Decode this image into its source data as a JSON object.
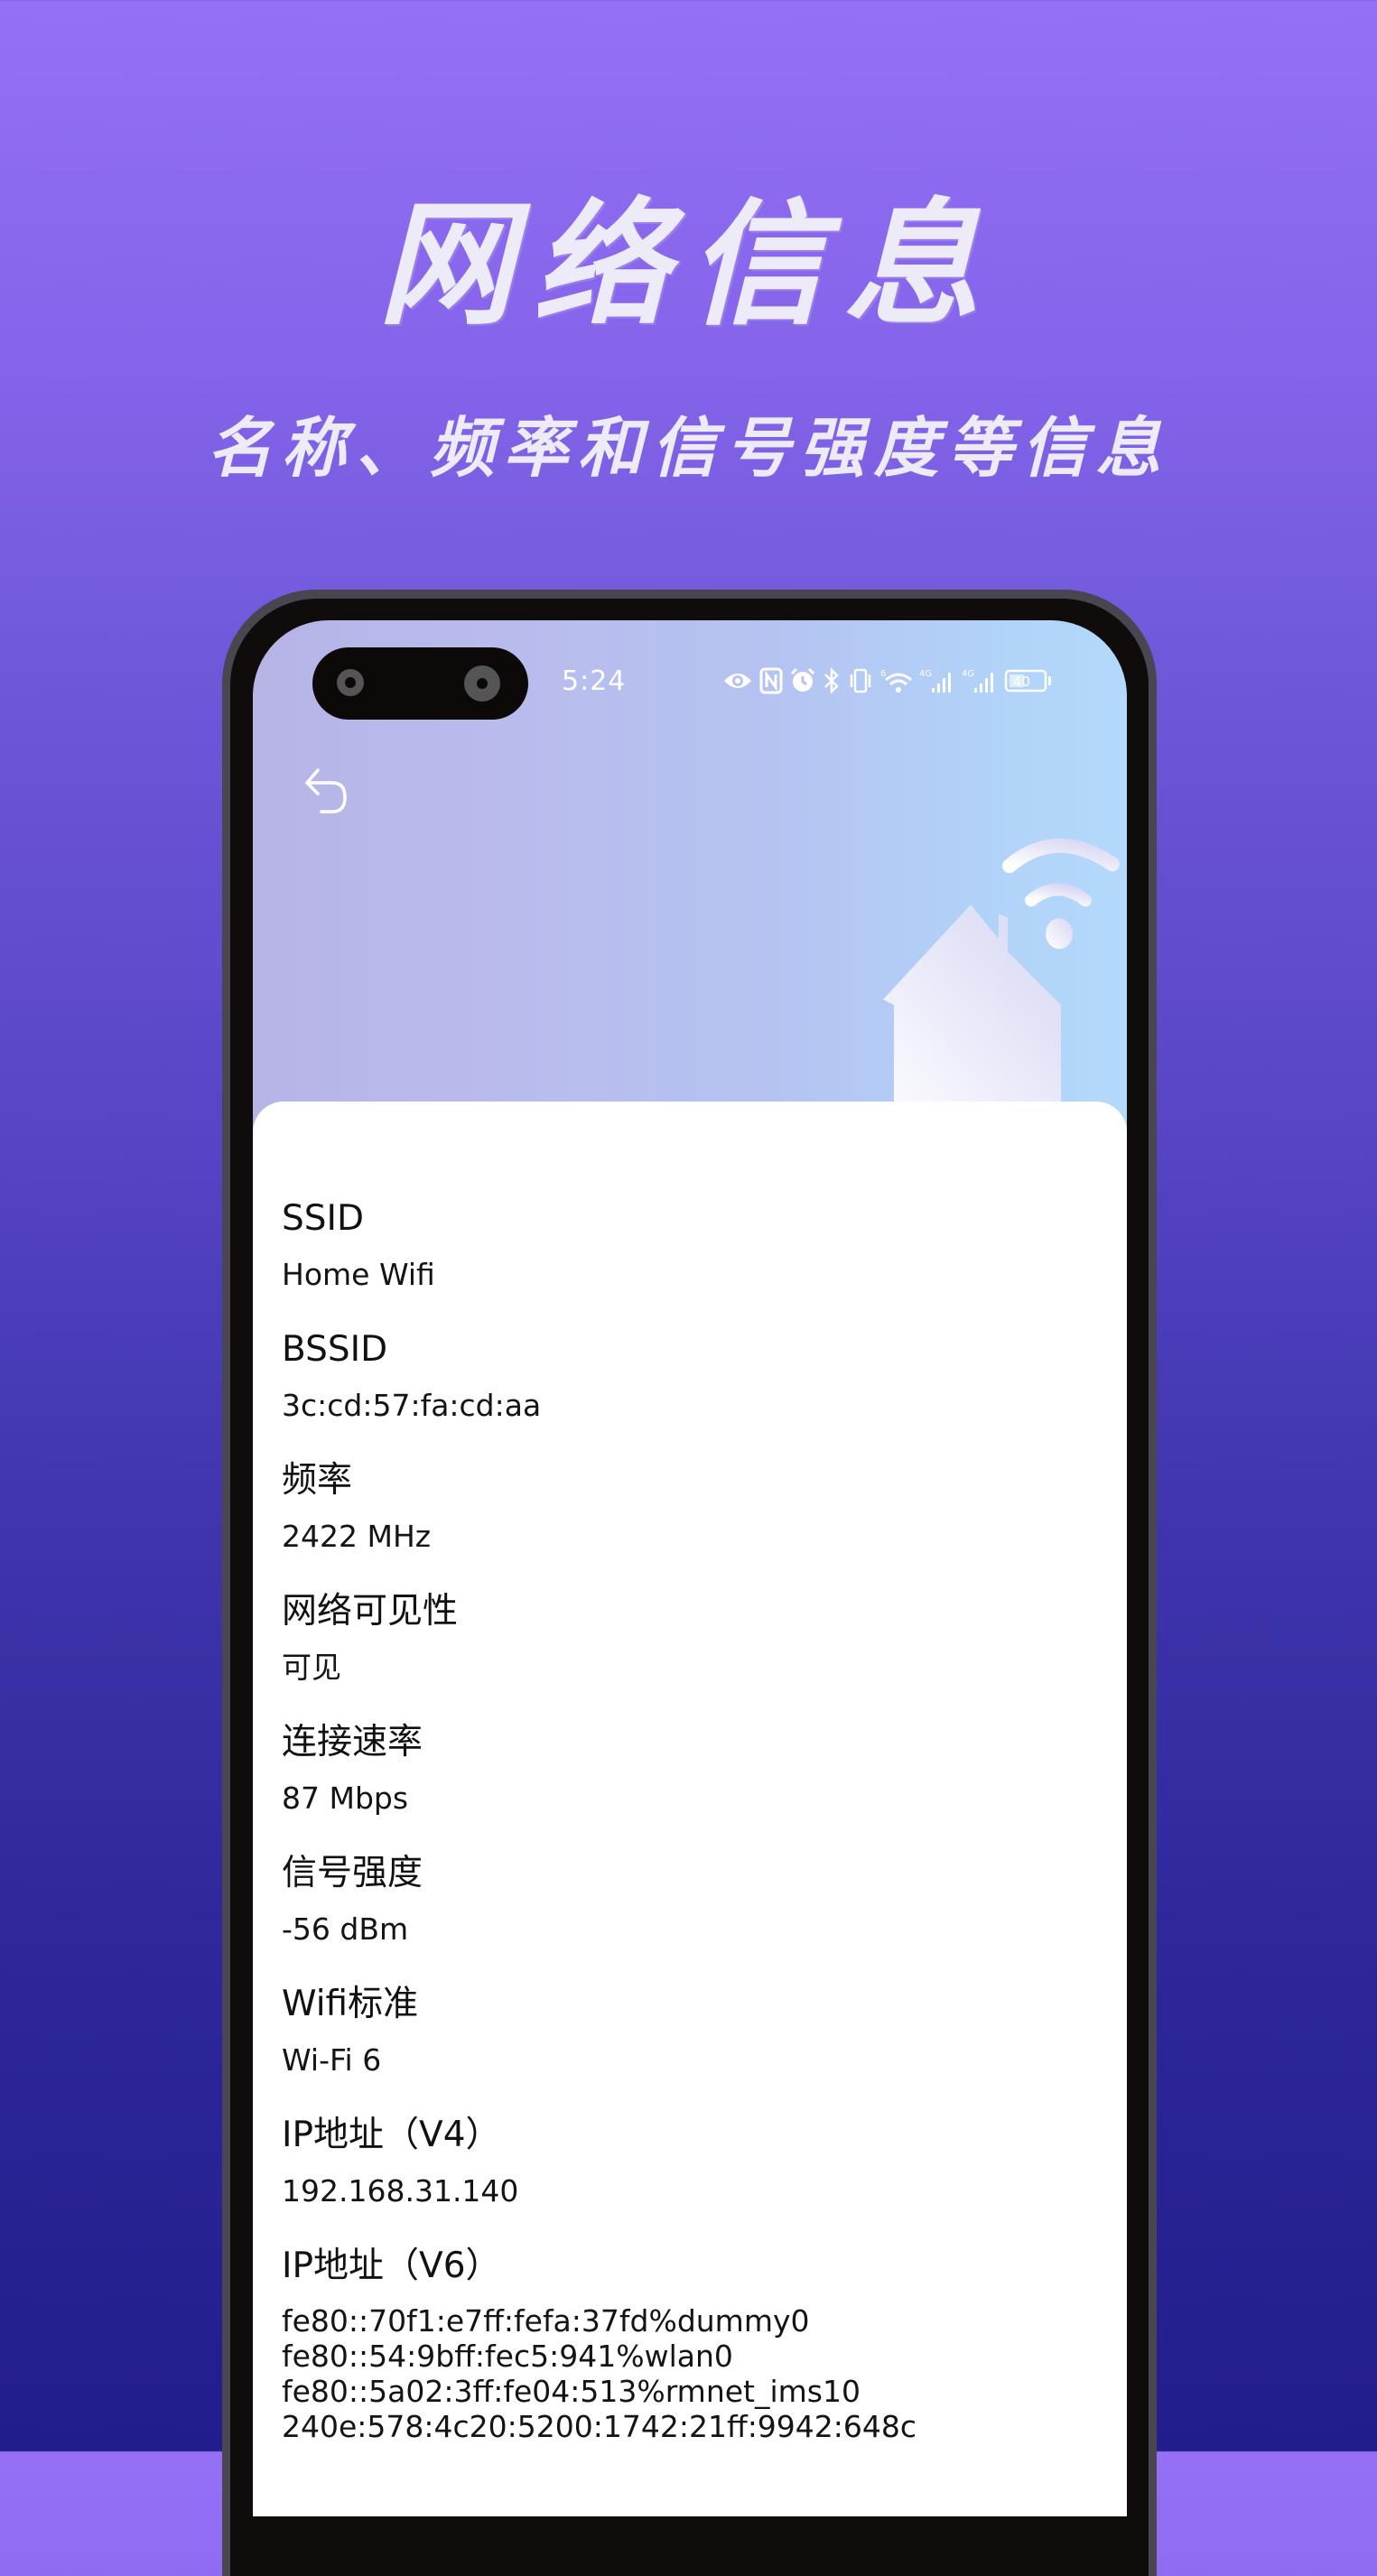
{
  "promo": {
    "headline": "网络信息",
    "subheadline": "名称、频率和信号强度等信息"
  },
  "status_bar": {
    "time": "5:24",
    "icons": [
      "eye-comfort-icon",
      "nfc-icon",
      "alarm-icon",
      "bluetooth-icon",
      "vibrate-icon",
      "wifi-6-icon",
      "signal-4g-1-icon",
      "signal-4g-2-icon",
      "battery-icon"
    ],
    "wifi_badge": "6",
    "network_badge_1": "4G",
    "network_badge_2": "4G",
    "battery_level": "40"
  },
  "header": {
    "back_icon": "back-arrow-icon",
    "illustration": "house-wifi-illustration"
  },
  "info": {
    "ssid": {
      "label": "SSID",
      "value": "Home Wifi"
    },
    "bssid": {
      "label": "BSSID",
      "value": "3c:cd:57:fa:cd:aa"
    },
    "frequency": {
      "label": "频率",
      "value": "2422 MHz"
    },
    "visibility": {
      "label": "网络可见性",
      "value": "可见"
    },
    "link_speed": {
      "label": "连接速率",
      "value": "87 Mbps"
    },
    "signal": {
      "label": "信号强度",
      "value": "-56 dBm"
    },
    "standard": {
      "label": "Wifi标准",
      "value": "Wi-Fi 6"
    },
    "ipv4": {
      "label": "IP地址（V4）",
      "value": "192.168.31.140"
    },
    "ipv6": {
      "label": "IP地址（V6）",
      "values": [
        "fe80::70f1:e7ff:fefa:37fd%dummy0",
        "fe80::54:9bff:fec5:941%wlan0",
        "fe80::5a02:3ff:fe04:513%rmnet_ims10",
        "240e:578:4c20:5200:1742:21ff:9942:648c"
      ]
    }
  }
}
